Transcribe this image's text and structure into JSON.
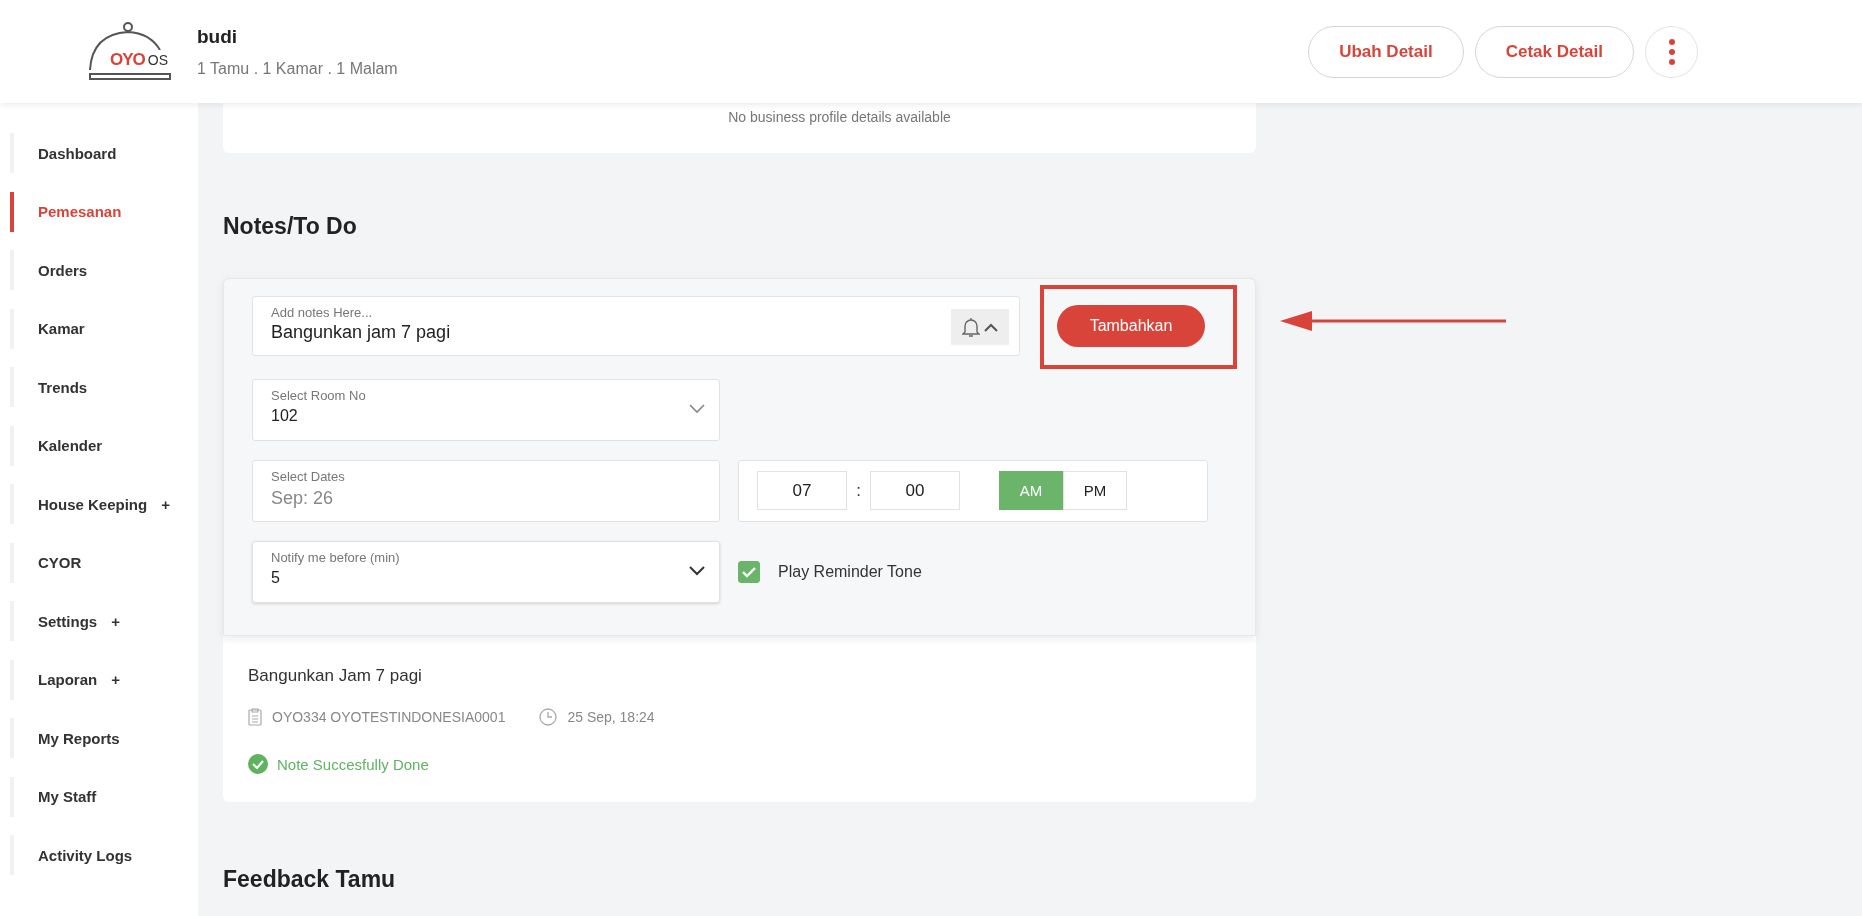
{
  "header": {
    "logo": {
      "brand": "OYO",
      "suffix": "OS"
    },
    "guest_name": "budi",
    "summary": "1 Tamu . 1 Kamar . 1 Malam",
    "actions": [
      "Ubah Detail",
      "Cetak Detail"
    ]
  },
  "sidebar": {
    "items": [
      {
        "label": "Dashboard",
        "selected": false
      },
      {
        "label": "Pemesanan",
        "selected": true
      },
      {
        "label": "Orders",
        "selected": false
      },
      {
        "label": "Kamar",
        "selected": false
      },
      {
        "label": "Trends",
        "selected": false
      },
      {
        "label": "Kalender",
        "selected": false
      },
      {
        "label": "House Keeping",
        "selected": false,
        "suffix": "+"
      },
      {
        "label": "CYOR",
        "selected": false
      },
      {
        "label": "Settings",
        "selected": false,
        "suffix": "+"
      },
      {
        "label": "Laporan",
        "selected": false,
        "suffix": "+"
      },
      {
        "label": "My Reports",
        "selected": false
      },
      {
        "label": "My Staff",
        "selected": false
      },
      {
        "label": "Activity Logs",
        "selected": false
      }
    ]
  },
  "business_profile": {
    "message": "No business profile details available"
  },
  "notes": {
    "title": "Notes/To Do",
    "note_input": {
      "label": "Add notes Here...",
      "value": "Bangunkan jam 7 pagi",
      "expanded": true
    },
    "add_button": "Tambahkan",
    "room": {
      "label": "Select Room No",
      "value": "102"
    },
    "dates": {
      "label": "Select Dates",
      "value": "Sep: 26"
    },
    "time": {
      "hour": "07",
      "separator": ":",
      "minute": "00",
      "periods": [
        {
          "label": "AM",
          "selected": true
        },
        {
          "label": "PM",
          "selected": false
        }
      ]
    },
    "notify": {
      "label": "Notify me before (min)",
      "value": "5"
    },
    "reminder_tone": {
      "label": "Play Reminder Tone",
      "checked": true
    },
    "items": [
      {
        "text": "Bangunkan Jam 7 pagi",
        "reference": "OYO334 OYOTESTINDONESIA0001",
        "time": "25 Sep, 18:24",
        "status": "Note Succesfully Done"
      }
    ]
  },
  "feedback": {
    "title": "Feedback Tamu"
  }
}
